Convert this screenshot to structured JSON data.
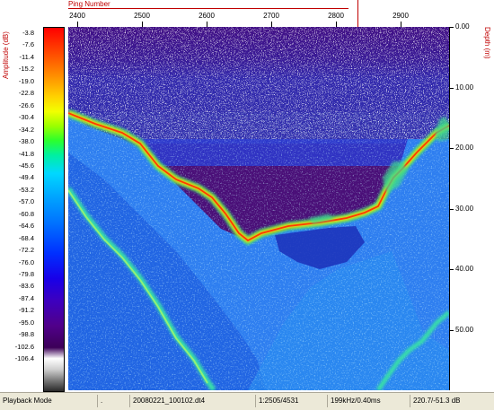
{
  "amplitude_scale": {
    "title": "Amplitude (dB)",
    "ticks": [
      "-3.8",
      "-7.6",
      "-11.4",
      "-15.2",
      "-19.0",
      "-22.8",
      "-26.6",
      "-30.4",
      "-34.2",
      "-38.0",
      "-41.8",
      "-45.6",
      "-49.4",
      "-53.2",
      "-57.0",
      "-60.8",
      "-64.6",
      "-68.4",
      "-72.2",
      "-76.0",
      "-79.8",
      "-83.6",
      "-87.4",
      "-91.2",
      "-95.0",
      "-98.8",
      "-102.6",
      "-106.4"
    ]
  },
  "ping_axis": {
    "title": "Ping Number",
    "ticks": [
      "2400",
      "2500",
      "2600",
      "2700",
      "2800",
      "2900"
    ]
  },
  "depth_axis": {
    "title": "Depth (m)",
    "ticks": [
      "0.00",
      "10.00",
      "20.00",
      "30.00",
      "40.00",
      "50.00"
    ]
  },
  "status_bar": {
    "mode": "Playback Mode",
    "separator": ".",
    "file": "20080221_100102.dt4",
    "position": "1:2505/4531",
    "frequency": "199kHz/0.40ms",
    "readout": "220.7/-51.3 dB"
  },
  "colors": {
    "background_noise": "#4a0f78",
    "water": "#2340d0",
    "bottom_echo": "#ffb000",
    "sub_bottom": "#3fa0ff",
    "secondary_echo": "#3cf0a0"
  }
}
